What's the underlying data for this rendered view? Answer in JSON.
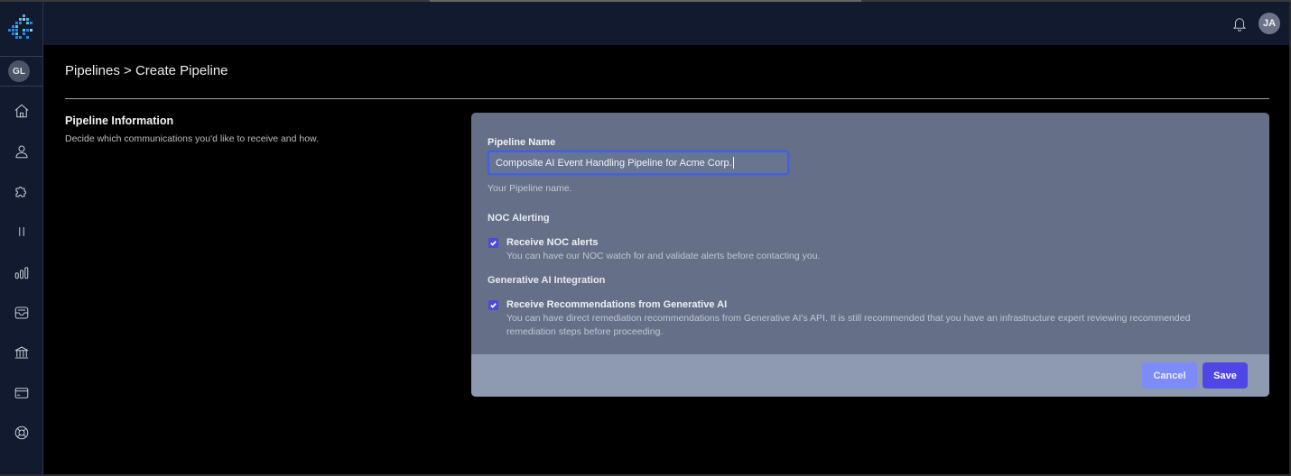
{
  "app": {
    "logo": "pixel-logo",
    "org_avatar_initials": "GL",
    "user_avatar_initials": "JA"
  },
  "sidebar": {
    "items": [
      {
        "name": "home",
        "icon": "home-icon"
      },
      {
        "name": "users",
        "icon": "user-icon"
      },
      {
        "name": "integrations",
        "icon": "puzzle-icon"
      },
      {
        "name": "pipelines",
        "icon": "pause-bars-icon"
      },
      {
        "name": "analytics",
        "icon": "bar-chart-icon"
      },
      {
        "name": "inbox",
        "icon": "inbox-icon"
      },
      {
        "name": "billing-institution",
        "icon": "bank-icon"
      },
      {
        "name": "payments",
        "icon": "credit-card-icon"
      },
      {
        "name": "support",
        "icon": "lifebuoy-icon"
      }
    ]
  },
  "header": {
    "notifications_icon": "bell-icon"
  },
  "page": {
    "breadcrumb": "Pipelines > Create Pipeline",
    "section_title": "Pipeline Information",
    "section_description": "Decide which communications you'd like to receive and how."
  },
  "form": {
    "pipeline_name": {
      "label": "Pipeline Name",
      "value": "Composite AI Event Handling Pipeline for Acme Corp.",
      "hint": "Your Pipeline name."
    },
    "noc": {
      "heading": "NOC Alerting",
      "checkbox_label": "Receive NOC alerts",
      "checked": true,
      "description": "You can have our NOC watch for and validate alerts before contacting you."
    },
    "genai": {
      "heading": "Generative AI Integration",
      "checkbox_label": "Receive Recommendations from Generative AI",
      "checked": true,
      "description_line1": "You can have direct remediation recommendations from Generative AI's API. It is still recommended that you have an infrastructure expert reviewing recommended",
      "description_line2": "remediation steps before proceeding."
    },
    "buttons": {
      "cancel": "Cancel",
      "save": "Save"
    }
  },
  "colors": {
    "sidebar_bg": "#111a2e",
    "card_bg": "#657088",
    "footer_bg": "#8e9ab0",
    "primary": "#4f46e5",
    "cancel": "#7d8bf8",
    "focus_ring": "#3f5fe8"
  }
}
